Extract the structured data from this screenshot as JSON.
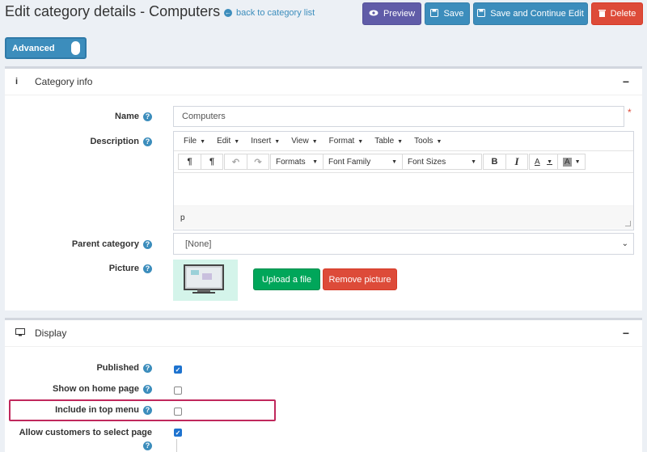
{
  "header": {
    "title": "Edit category details - Computers",
    "back_link": "back to category list",
    "buttons": {
      "preview": "Preview",
      "save": "Save",
      "save_continue": "Save and Continue Edit",
      "delete": "Delete"
    }
  },
  "advanced_toggle": {
    "label": "Advanced",
    "enabled": true
  },
  "category_info": {
    "title": "Category info",
    "name_label": "Name",
    "name_value": "Computers",
    "required_mark": "*",
    "description_label": "Description",
    "editor": {
      "menu": [
        "File",
        "Edit",
        "Insert",
        "View",
        "Format",
        "Table",
        "Tools"
      ],
      "formats": "Formats",
      "font_family": "Font Family",
      "font_sizes": "Font Sizes",
      "bold": "B",
      "italic": "I",
      "text_color": "A",
      "bg_color": "A",
      "status_path": "p"
    },
    "parent_label": "Parent category",
    "parent_value": "[None]",
    "picture_label": "Picture",
    "upload_label": "Upload a file",
    "remove_label": "Remove picture"
  },
  "display": {
    "title": "Display",
    "published_label": "Published",
    "published": true,
    "home_label": "Show on home page",
    "home": false,
    "topmenu_label": "Include in top menu",
    "topmenu": false,
    "pagesize_label_1": "Allow customers to select page",
    "pagesize_label_2": "size",
    "pagesize": true
  },
  "icons": {
    "help": "?",
    "info": "i",
    "collapse": "−",
    "check": "✓"
  },
  "colors": {
    "primary": "#3c8dbc",
    "preview": "#605ca8",
    "danger": "#dd4b39",
    "success": "#00a65a",
    "highlight": "#c0285c"
  }
}
